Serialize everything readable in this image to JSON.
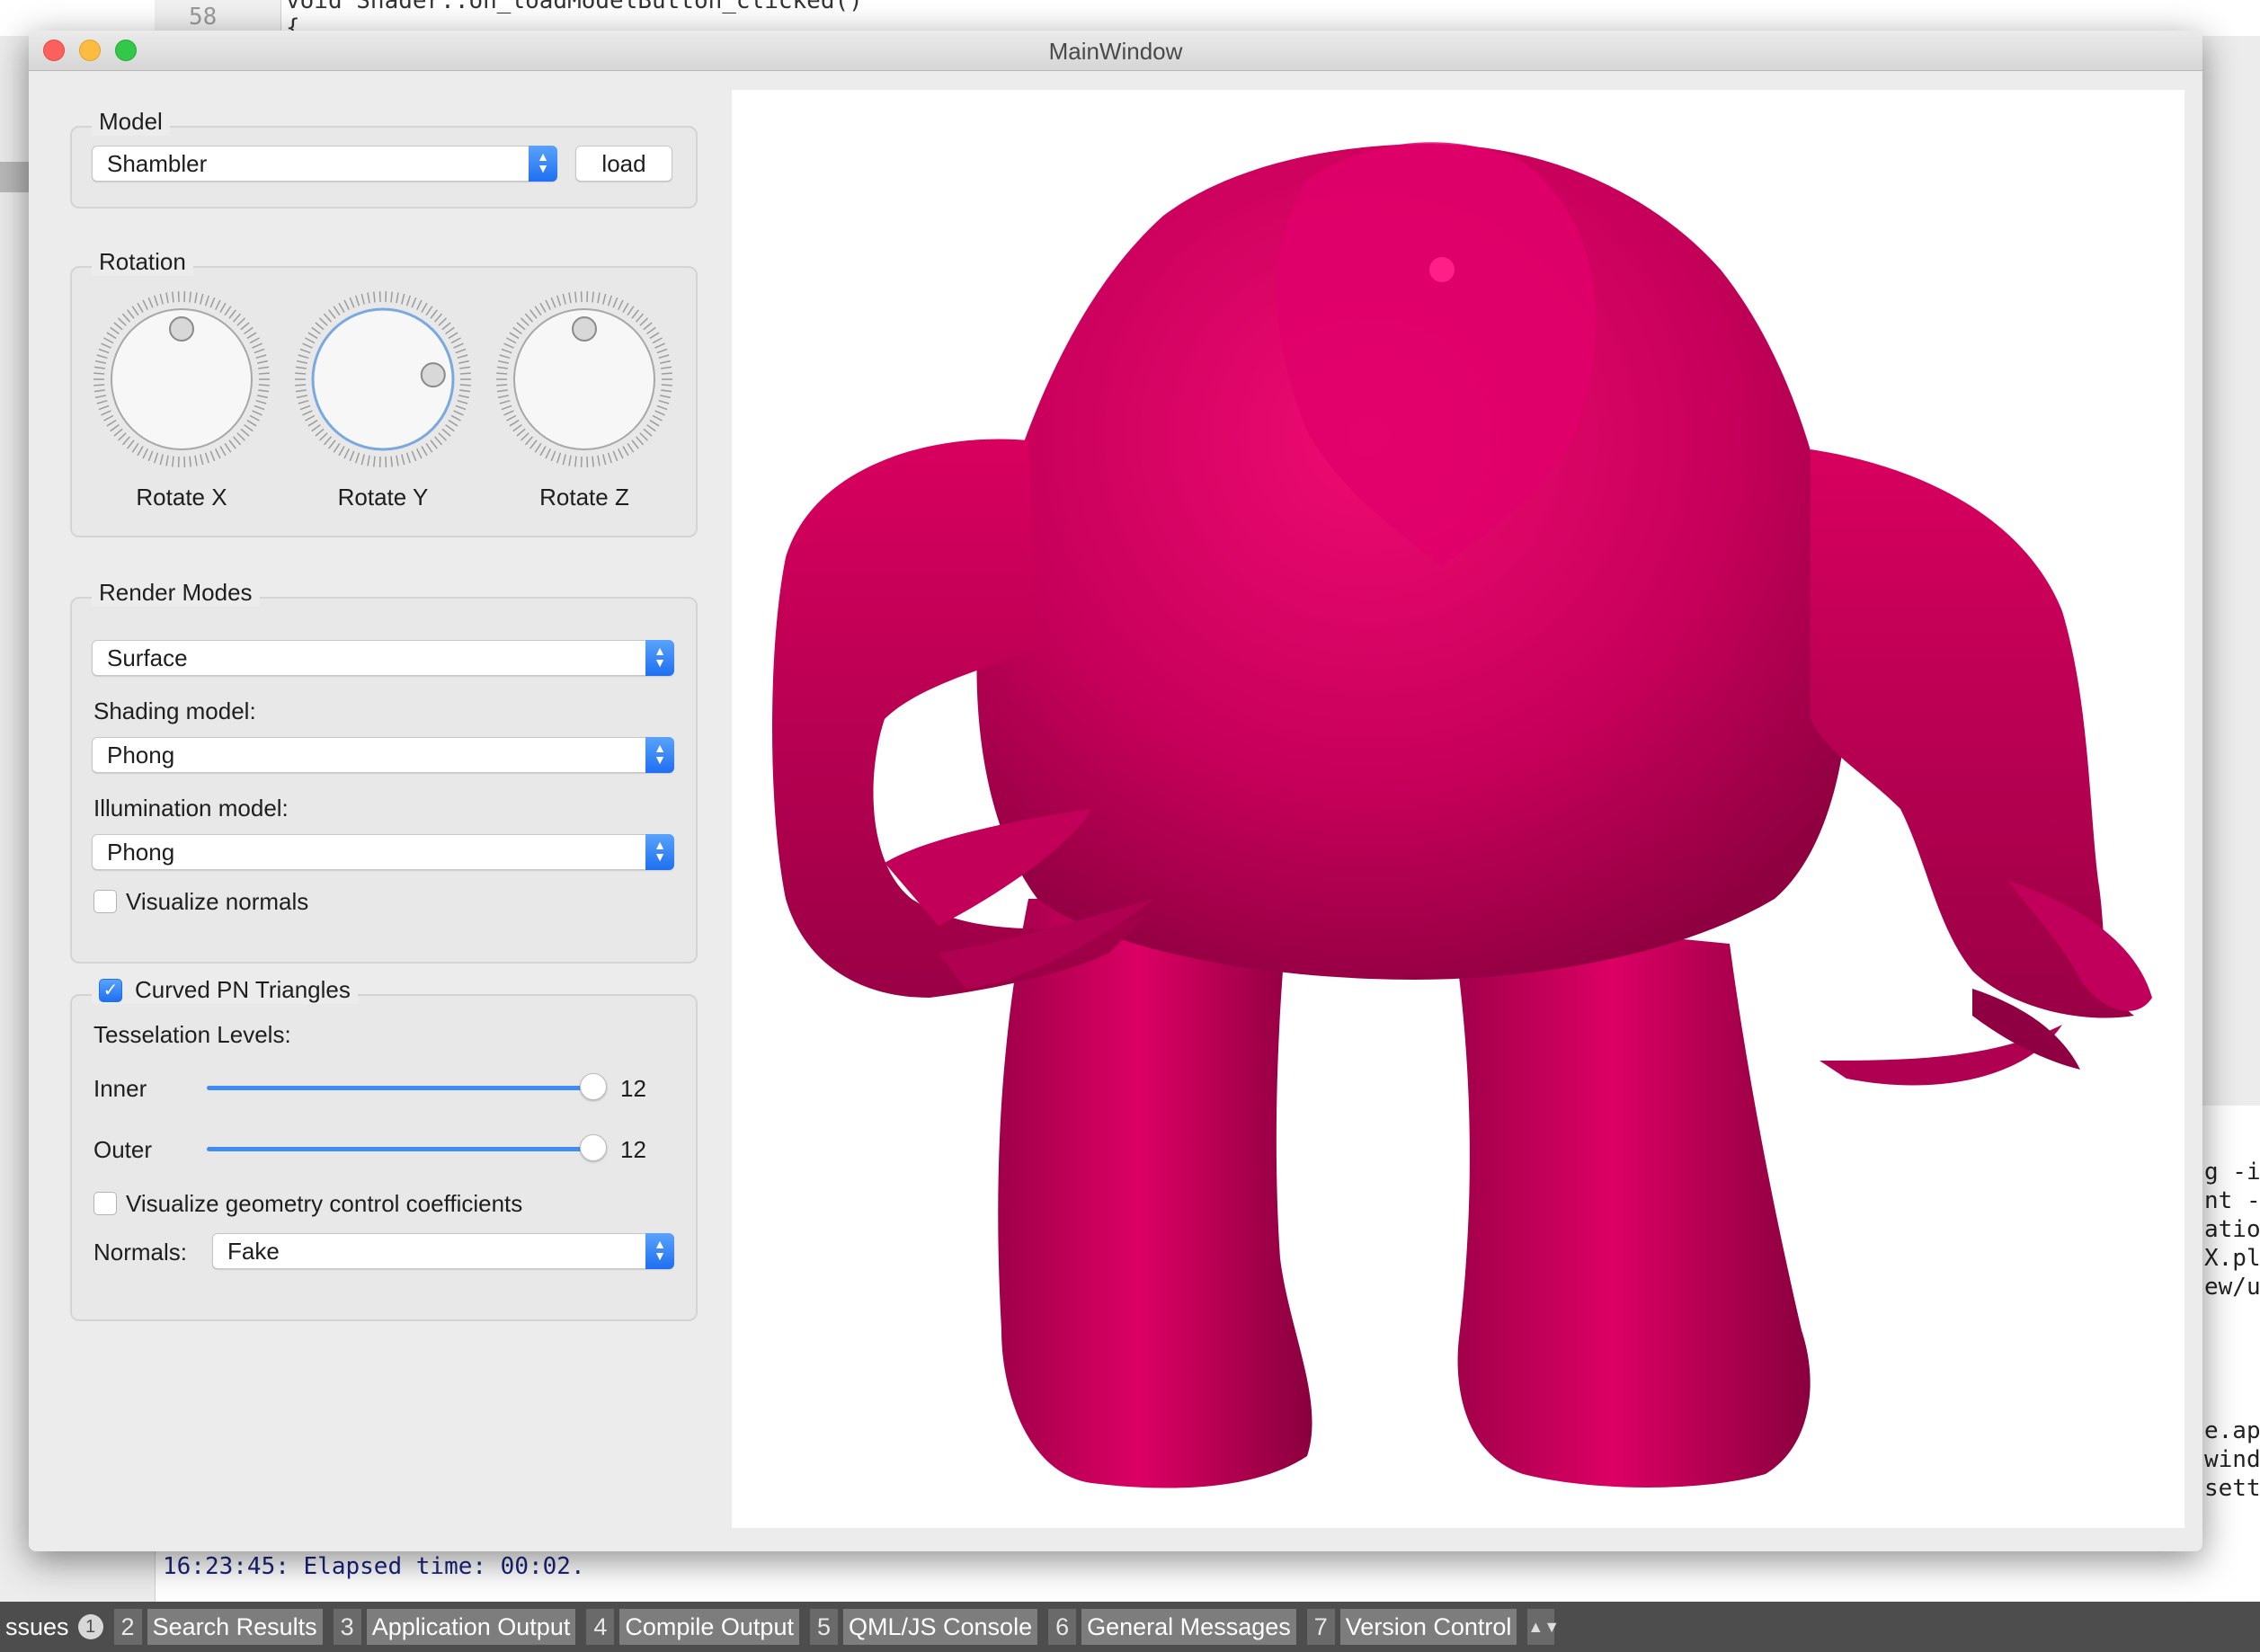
{
  "ide": {
    "line_number": "58",
    "code_line": "void Shader::on_loadModelButton_clicked()\n{",
    "right_panel_lines": [
      "g -is",
      "nt -I",
      "ation",
      "X.pl",
      "ew/u",
      "",
      "",
      "",
      "",
      "e.app",
      "windo",
      "setti"
    ],
    "output_line": "16:23:45: Elapsed time: 00:02.",
    "tabs": [
      {
        "num": "",
        "label": "ssues",
        "badge": "1"
      },
      {
        "num": "2",
        "label": "Search Results"
      },
      {
        "num": "3",
        "label": "Application Output"
      },
      {
        "num": "4",
        "label": "Compile Output"
      },
      {
        "num": "5",
        "label": "QML/JS Console"
      },
      {
        "num": "6",
        "label": "General Messages"
      },
      {
        "num": "7",
        "label": "Version Control"
      }
    ]
  },
  "window": {
    "title": "MainWindow"
  },
  "model": {
    "group_title": "Model",
    "selected": "Shambler",
    "load_label": "load"
  },
  "rotation": {
    "group_title": "Rotation",
    "dials": [
      {
        "label": "Rotate X",
        "angle_deg": 180
      },
      {
        "label": "Rotate Y",
        "angle_deg": 265
      },
      {
        "label": "Rotate Z",
        "angle_deg": 180
      }
    ]
  },
  "render_modes": {
    "group_title": "Render Modes",
    "mode": "Surface",
    "shading_label": "Shading model:",
    "shading": "Phong",
    "illumination_label": "Illumination model:",
    "illumination": "Phong",
    "visualize_normals_label": "Visualize normals",
    "visualize_normals": false
  },
  "pn": {
    "group_title": "Curved PN Triangles",
    "enabled": true,
    "tess_label": "Tesselation Levels:",
    "inner_label": "Inner",
    "inner_value": "12",
    "inner_fraction": 1.0,
    "outer_label": "Outer",
    "outer_value": "12",
    "outer_fraction": 1.0,
    "vis_gcc_label": "Visualize geometry control coefficients",
    "vis_gcc": false,
    "normals_label": "Normals:",
    "normals": "Fake"
  },
  "colors": {
    "model": "#d6005f",
    "accent": "#1f6ff1"
  }
}
